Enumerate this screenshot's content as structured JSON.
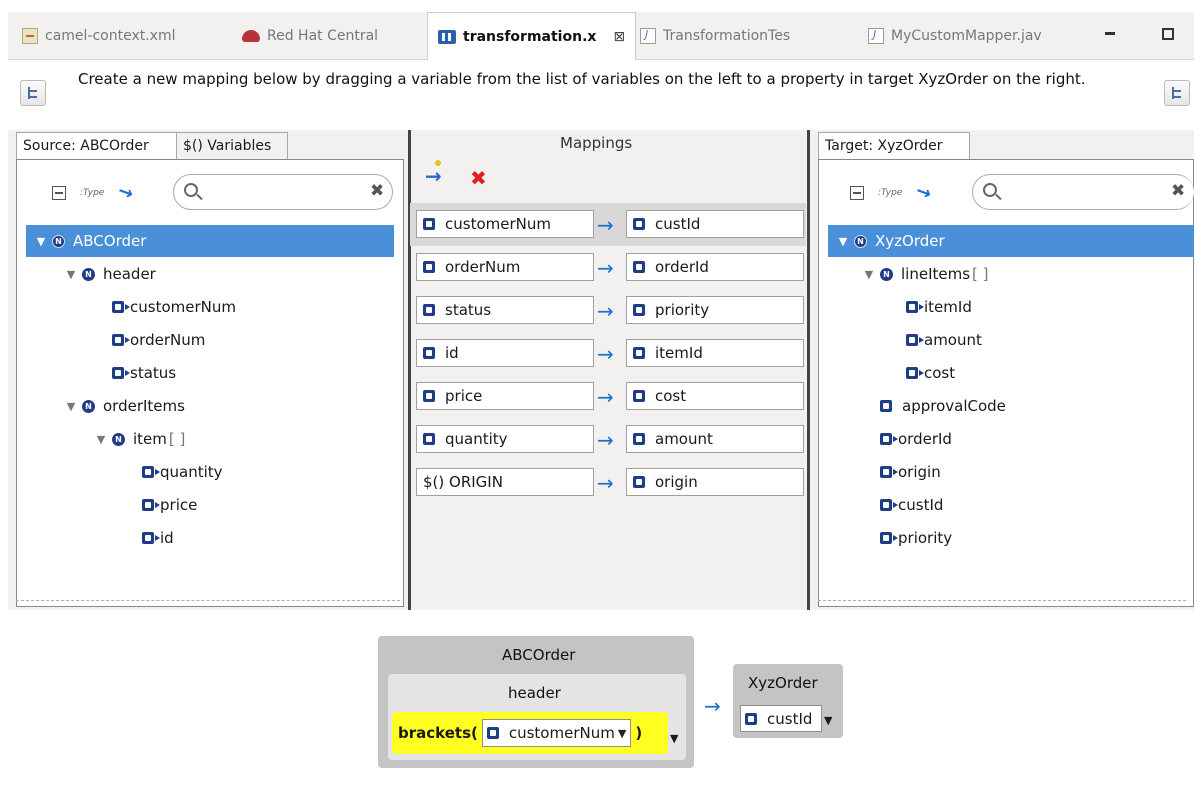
{
  "tabs": [
    {
      "label": "camel-context.xml",
      "icon": "xml-file-icon"
    },
    {
      "label": "Red Hat Central",
      "icon": "redhat-icon"
    },
    {
      "label": "transformation.x",
      "icon": "data-mapper-icon",
      "close": "⊠"
    },
    {
      "label": "TransformationTes",
      "icon": "java-file-icon"
    },
    {
      "label": "MyCustomMapper.jav",
      "icon": "java-file-icon"
    }
  ],
  "instruction": "Create a new mapping below by dragging a variable from the list of variables on the left to a property in target XyzOrder on the right.",
  "source": {
    "tab_label": "Source: ABCOrder",
    "variables_tab_label": "$() Variables",
    "tree": [
      {
        "label": "ABCOrder",
        "kind": "node",
        "level": 0,
        "expanded": true,
        "selected": true
      },
      {
        "label": "header",
        "kind": "node",
        "level": 1,
        "expanded": true
      },
      {
        "label": "customerNum",
        "kind": "leaf",
        "level": 2
      },
      {
        "label": "orderNum",
        "kind": "leaf",
        "level": 2
      },
      {
        "label": "status",
        "kind": "leaf",
        "level": 2
      },
      {
        "label": "orderItems",
        "kind": "node",
        "level": 1,
        "expanded": true
      },
      {
        "label": "item",
        "kind": "collection",
        "level": 2,
        "expanded": true,
        "suffix": "[ ]"
      },
      {
        "label": "quantity",
        "kind": "leaf",
        "level": 3
      },
      {
        "label": "price",
        "kind": "leaf",
        "level": 3
      },
      {
        "label": "id",
        "kind": "leaf",
        "level": 3
      }
    ]
  },
  "mappings": {
    "title": "Mappings",
    "rows": [
      {
        "source": "customerNum",
        "target": "custId",
        "selected": true,
        "source_icon": "custom-function-icon"
      },
      {
        "source": "orderNum",
        "target": "orderId"
      },
      {
        "source": "status",
        "target": "priority"
      },
      {
        "source": "id",
        "target": "itemId"
      },
      {
        "source": "price",
        "target": "cost"
      },
      {
        "source": "quantity",
        "target": "amount"
      },
      {
        "source": "$() ORIGIN",
        "target": "origin",
        "source_is_variable": true
      }
    ]
  },
  "target": {
    "tab_label": "Target: XyzOrder",
    "tree": [
      {
        "label": "XyzOrder",
        "kind": "node",
        "level": 0,
        "expanded": true,
        "selected": true
      },
      {
        "label": "lineItems",
        "kind": "collection",
        "level": 1,
        "expanded": true,
        "suffix": "[ ]"
      },
      {
        "label": "itemId",
        "kind": "leaf",
        "level": 2
      },
      {
        "label": "amount",
        "kind": "leaf",
        "level": 2
      },
      {
        "label": "cost",
        "kind": "leaf",
        "level": 2
      },
      {
        "label": "approvalCode",
        "kind": "leaf-plain",
        "level": 1
      },
      {
        "label": "orderId",
        "kind": "leaf",
        "level": 1
      },
      {
        "label": "origin",
        "kind": "leaf",
        "level": 1
      },
      {
        "label": "custId",
        "kind": "leaf",
        "level": 1
      },
      {
        "label": "priority",
        "kind": "leaf",
        "level": 1
      }
    ]
  },
  "detail": {
    "source_root": "ABCOrder",
    "source_parent": "header",
    "function_name": "brackets(",
    "function_close": ")",
    "function_arg": "customerNum",
    "target_root": "XyzOrder",
    "target_field": "custId"
  },
  "colors": {
    "selection": "#4a90d9",
    "function_highlight": "#ffff22",
    "mapping_arrow": "#1e6fd0"
  }
}
